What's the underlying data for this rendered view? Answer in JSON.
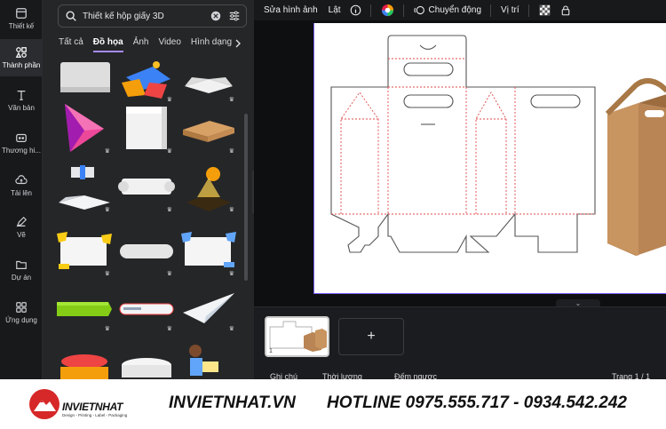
{
  "sidebar": {
    "items": [
      {
        "label": "Thiết kế",
        "icon": "design-icon"
      },
      {
        "label": "Thành phần",
        "icon": "elements-icon"
      },
      {
        "label": "Văn bản",
        "icon": "text-icon"
      },
      {
        "label": "Thương hi...",
        "icon": "brand-icon"
      },
      {
        "label": "Tải lên",
        "icon": "upload-icon"
      },
      {
        "label": "Vẽ",
        "icon": "draw-icon"
      },
      {
        "label": "Dự án",
        "icon": "folder-icon"
      },
      {
        "label": "Ứng dụng",
        "icon": "apps-icon"
      }
    ]
  },
  "panel": {
    "search": {
      "value": "Thiết kế hộp giấy 3D"
    },
    "tabs": [
      "Tất cả",
      "Đồ họa",
      "Ảnh",
      "Video",
      "Hình dạng"
    ],
    "active_tab": "Đồ họa"
  },
  "toolbar": {
    "edit_image": "Sửa hình ảnh",
    "flip": "Lật",
    "animate": "Chuyển động",
    "position": "Vị trí"
  },
  "pages": {
    "notes": "Ghi chú",
    "duration": "Thời lượng",
    "timer": "Đếm ngược",
    "page_count": "Trang 1 / 1",
    "thumb_number": "1",
    "add_symbol": "+"
  },
  "footer": {
    "brand_name": "INVIETNHAT",
    "brand_tag": "Design - Printing - Label - Packaging",
    "website": "INVIETNHAT.VN",
    "hotline": "HOTLINE 0975.555.717 - 0934.542.242"
  },
  "colors": {
    "accent": "#a78bfa",
    "canvas_border": "#7b5cff",
    "brand_red": "#d62828"
  }
}
